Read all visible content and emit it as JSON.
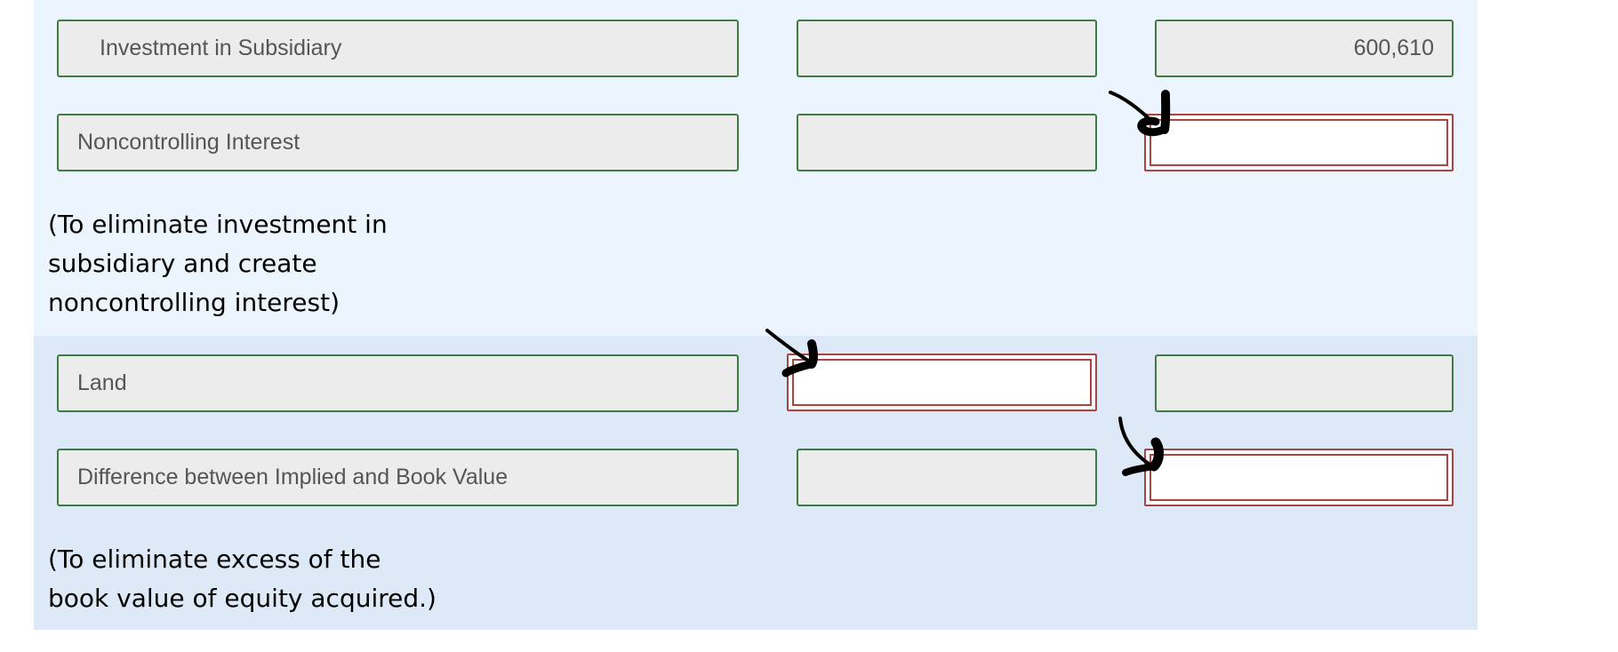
{
  "entry1": {
    "rows": [
      {
        "account": "Investment in Subsidiary",
        "debit": "",
        "credit": "600,610",
        "credit_state": "filled"
      },
      {
        "account": "Noncontrolling Interest",
        "debit": "",
        "credit": "",
        "credit_state": "error-empty"
      }
    ],
    "note_lines": [
      "(To eliminate investment in",
      "subsidiary and create",
      "noncontrolling interest)"
    ]
  },
  "entry2": {
    "rows": [
      {
        "account": "Land",
        "debit": "",
        "debit_state": "error-empty",
        "credit": ""
      },
      {
        "account": "Difference between Implied and Book Value",
        "debit": "",
        "credit": "",
        "credit_state": "error-empty"
      }
    ],
    "note_lines": [
      "(To eliminate excess of the",
      "book value of equity acquired.)"
    ]
  },
  "annotations": {
    "arrow_icons": [
      "hand-drawn-arrow-to-noncontrolling-credit",
      "hand-drawn-arrow-to-land-debit",
      "hand-drawn-arrow-to-difference-credit"
    ]
  },
  "colors": {
    "section1_bg": "#ecf4fe",
    "section2_bg": "#dde9f7",
    "field_border": "#3f7a46",
    "error_border": "#a94442",
    "field_bg": "#ececec"
  }
}
